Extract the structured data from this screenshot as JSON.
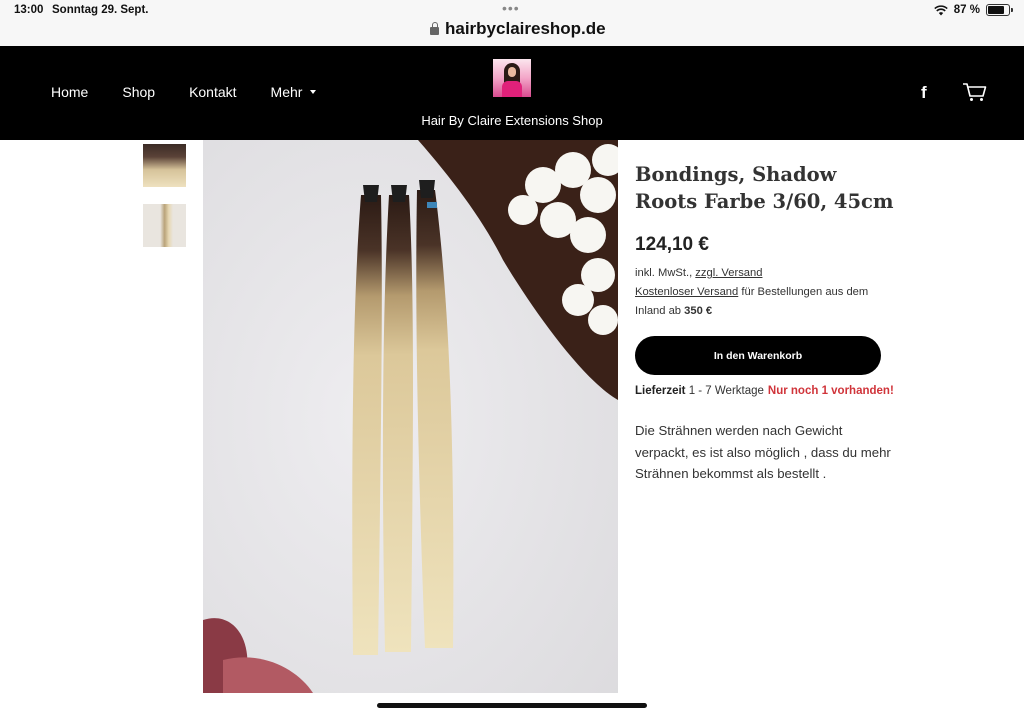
{
  "status_bar": {
    "time": "13:00",
    "date": "Sonntag 29. Sept.",
    "url": "hairbyclaireshop.de",
    "battery": "87 %",
    "battery_level": 0.87,
    "icons": [
      "wifi-icon",
      "battery-icon",
      "lock-icon"
    ]
  },
  "header": {
    "nav": [
      "Home",
      "Shop",
      "Kontakt",
      "Mehr"
    ],
    "site_title": "Hair By Claire Extensions Shop",
    "icons": [
      "facebook-icon",
      "cart-icon"
    ]
  },
  "product": {
    "title": "Bondings, Shadow Roots Farbe 3/60, 45cm",
    "price": "124,10 €",
    "tax_prefix": "inkl. MwSt., ",
    "shipping_link": "zzgl. Versand",
    "free_shipping_link": "Kostenloser Versand",
    "free_shipping_text": " für Bestellungen aus dem Inland ab ",
    "free_shipping_amount": "350 €",
    "add_to_cart": "In den Warenkorb",
    "delivery_label": "Lieferzeit",
    "delivery_time": " 1 - 7 Werktage",
    "stock_note": "Nur noch 1 vorhanden!",
    "description": "Die Strähnen werden nach Gewicht verpackt, es ist also möglich , dass du mehr Strähnen bekommst als bestellt ."
  },
  "colors": {
    "header_bg": "#000000",
    "accent_button": "#000000",
    "stock_red": "#d0343a"
  }
}
